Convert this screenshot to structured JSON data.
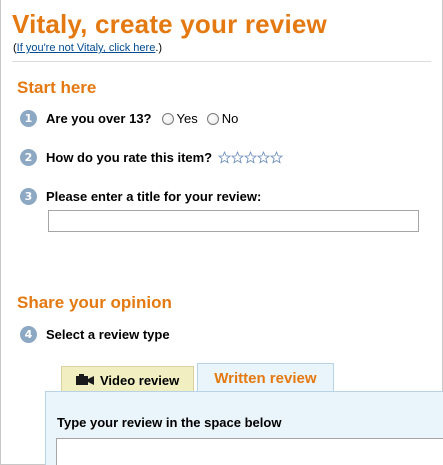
{
  "header": {
    "title": "Vitaly, create your review",
    "not_user_prefix": "(",
    "not_user_link": "If you're not Vitaly, click here",
    "not_user_suffix": ".)"
  },
  "start_section": {
    "title": "Start here",
    "q1": {
      "number": "1",
      "label": "Are you over 13?",
      "options": [
        "Yes",
        "No"
      ]
    },
    "q2": {
      "number": "2",
      "label": "How do you rate this item?",
      "stars": 5
    },
    "q3": {
      "number": "3",
      "label": "Please enter a title for your review:",
      "value": ""
    }
  },
  "opinion_section": {
    "title": "Share your opinion",
    "q4": {
      "number": "4",
      "label": "Select a review type"
    },
    "tabs": {
      "video": "Video review",
      "written": "Written review"
    },
    "panel_label": "Type your review in the space below",
    "review_text": ""
  },
  "colors": {
    "accent": "#e47911",
    "link": "#004b91",
    "step_badge": "#8da8c3",
    "panel_bg": "#eaf4fb",
    "video_tab_bg": "#f1efc2"
  }
}
